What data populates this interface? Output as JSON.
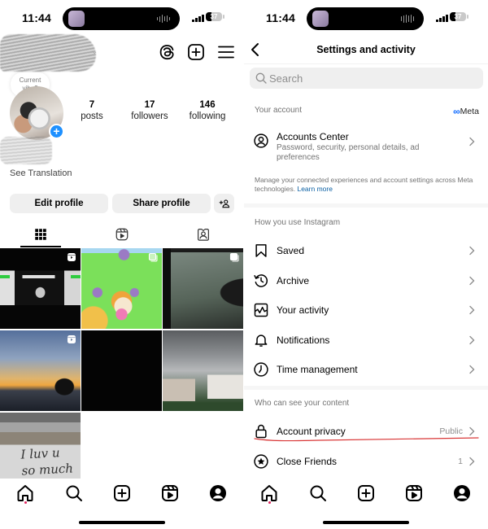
{
  "status_bar": {
    "time": "11:44",
    "battery_level": "37"
  },
  "profile_screen": {
    "current_vibe_prompt": "Current vibe?",
    "stats": [
      {
        "value": "7",
        "label": "posts"
      },
      {
        "value": "17",
        "label": "followers"
      },
      {
        "value": "146",
        "label": "following"
      }
    ],
    "see_translation": "See Translation",
    "buttons": {
      "edit_profile": "Edit profile",
      "share_profile": "Share profile"
    },
    "tabs": [
      {
        "name": "posts-grid",
        "icon": "grid-icon",
        "selected": true
      },
      {
        "name": "reels",
        "icon": "reels-icon",
        "selected": false
      },
      {
        "name": "tagged",
        "icon": "tagged-icon",
        "selected": false
      }
    ],
    "posts": [
      {
        "description": "concert stage, dark",
        "type": "reel"
      },
      {
        "description": "pixel game screenshot with hamster",
        "type": "carousel"
      },
      {
        "description": "foggy view through train window",
        "type": "carousel"
      },
      {
        "description": "sunset skyline with palm trees",
        "type": "reel"
      },
      {
        "description": "dark photo",
        "type": "photo"
      },
      {
        "description": "cloudy sky over buildings",
        "type": "photo"
      },
      {
        "description": "wall writing",
        "type": "photo",
        "text": "I luv u\nso much"
      }
    ]
  },
  "settings_screen": {
    "title": "Settings and activity",
    "search_placeholder": "Search",
    "your_account": {
      "label": "Your account",
      "meta_brand": "Meta",
      "accounts_center": {
        "title": "Accounts Center",
        "subtitle": "Password, security, personal details, ad preferences"
      },
      "note": "Manage your connected experiences and account settings across Meta technologies.",
      "learn_more": "Learn more"
    },
    "how_you_use": {
      "label": "How you use Instagram",
      "items": [
        {
          "label": "Saved",
          "icon": "bookmark-icon"
        },
        {
          "label": "Archive",
          "icon": "archive-icon"
        },
        {
          "label": "Your activity",
          "icon": "activity-icon"
        },
        {
          "label": "Notifications",
          "icon": "bell-icon"
        },
        {
          "label": "Time management",
          "icon": "clock-icon"
        }
      ]
    },
    "who_can_see": {
      "label": "Who can see your content",
      "items": [
        {
          "label": "Account privacy",
          "value": "Public",
          "icon": "lock-icon"
        },
        {
          "label": "Close Friends",
          "value": "1",
          "icon": "star-icon"
        }
      ]
    }
  },
  "bottom_nav": {
    "items": [
      "home",
      "search",
      "create",
      "reels",
      "profile"
    ],
    "active": "home"
  },
  "colors": {
    "accent_blue": "#1e90ff",
    "link_blue": "#0a5fa3",
    "meta_blue": "#0866ff",
    "annotation_red": "#d93838",
    "notification_dot": "#e0245e"
  }
}
